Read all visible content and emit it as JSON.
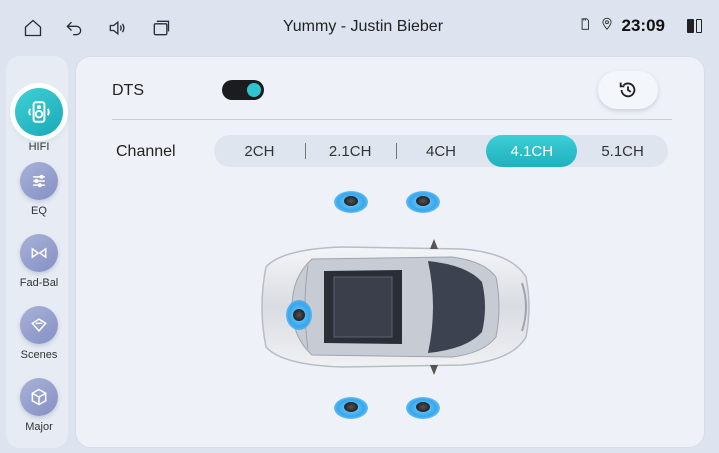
{
  "status_bar": {
    "now_playing": "Yummy - Justin Bieber",
    "time": "23:09",
    "icons": [
      "home-icon",
      "back-icon",
      "volume-icon",
      "recent-apps-icon",
      "sd-card-icon",
      "location-icon",
      "split-screen-icon"
    ]
  },
  "sidebar": {
    "items": [
      {
        "label": "HIFI",
        "icon": "speaker-icon",
        "active": true
      },
      {
        "label": "EQ",
        "icon": "sliders-icon",
        "active": false
      },
      {
        "label": "Fad-Bal",
        "icon": "fader-icon",
        "active": false
      },
      {
        "label": "Scenes",
        "icon": "scenes-icon",
        "active": false
      },
      {
        "label": "Major",
        "icon": "cube-icon",
        "active": false
      }
    ]
  },
  "main": {
    "dts_label": "DTS",
    "dts_enabled": true,
    "channel_label": "Channel",
    "channels": [
      "2CH",
      "2.1CH",
      "4CH",
      "4.1CH",
      "5.1CH"
    ],
    "selected_channel": "4.1CH"
  },
  "colors": {
    "accent": "#22b7c3",
    "speaker_glow": "#35a7ee",
    "background": "#dde4ef"
  }
}
